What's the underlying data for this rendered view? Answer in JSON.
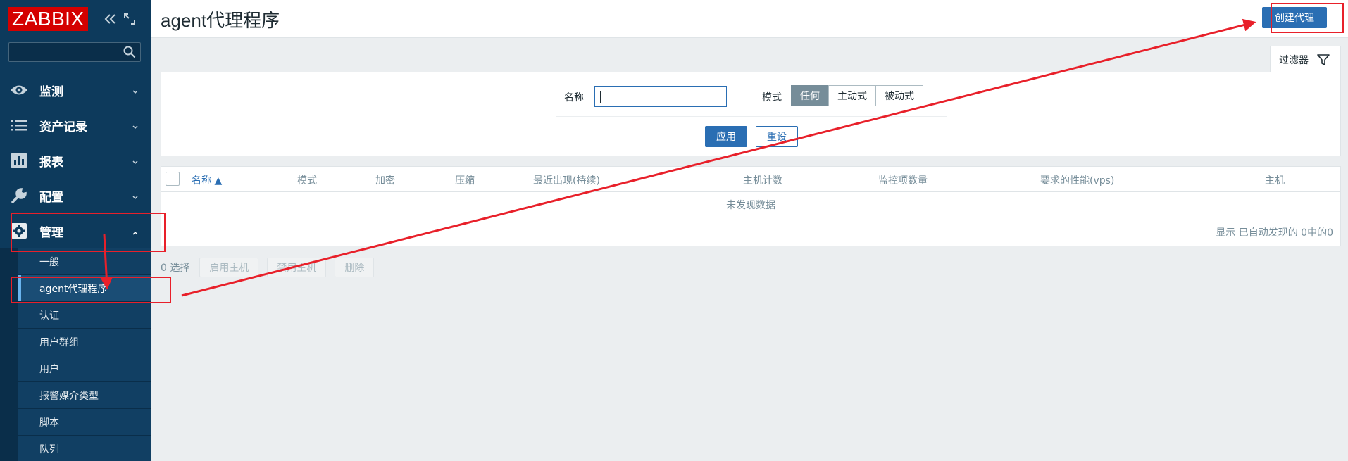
{
  "sidebar": {
    "logo": "ZABBIX",
    "collapse_icon": "double-chevron-left-icon",
    "kiosk_icon": "fullscreen-icon",
    "search": {
      "value": "",
      "icon": "search-icon"
    },
    "menu": [
      {
        "label": "监测",
        "icon": "eye-icon"
      },
      {
        "label": "资产记录",
        "icon": "list-icon"
      },
      {
        "label": "报表",
        "icon": "bar-chart-icon"
      },
      {
        "label": "配置",
        "icon": "wrench-icon"
      },
      {
        "label": "管理",
        "icon": "gear-icon"
      }
    ],
    "submenu": [
      {
        "label": "一般"
      },
      {
        "label": "agent代理程序"
      },
      {
        "label": "认证"
      },
      {
        "label": "用户群组"
      },
      {
        "label": "用户"
      },
      {
        "label": "报警媒介类型"
      },
      {
        "label": "脚本"
      },
      {
        "label": "队列"
      }
    ]
  },
  "header": {
    "title": "agent代理程序",
    "create_label": "创建代理"
  },
  "filter": {
    "tab_label": "过滤器",
    "name_label": "名称",
    "name_value": "",
    "mode_label": "模式",
    "mode_options": [
      "任何",
      "主动式",
      "被动式"
    ],
    "mode_selected": "任何",
    "apply_label": "应用",
    "reset_label": "重设"
  },
  "table": {
    "columns": [
      "名称 ▲",
      "模式",
      "加密",
      "压缩",
      "最近出现(持续)",
      "主机计数",
      "监控项数量",
      "要求的性能(vps)",
      "主机"
    ],
    "empty_text": "未发现数据",
    "summary": "显示 已自动发现的 0中的0"
  },
  "actions": {
    "selected_count": "0 选择",
    "buttons": [
      "启用主机",
      "禁用主机",
      "删除"
    ]
  },
  "colors": {
    "sidebar_bg": "#0d3a5c",
    "accent": "#2a6eb3",
    "annotation": "#e8202a",
    "logo_bg": "#d40000"
  }
}
